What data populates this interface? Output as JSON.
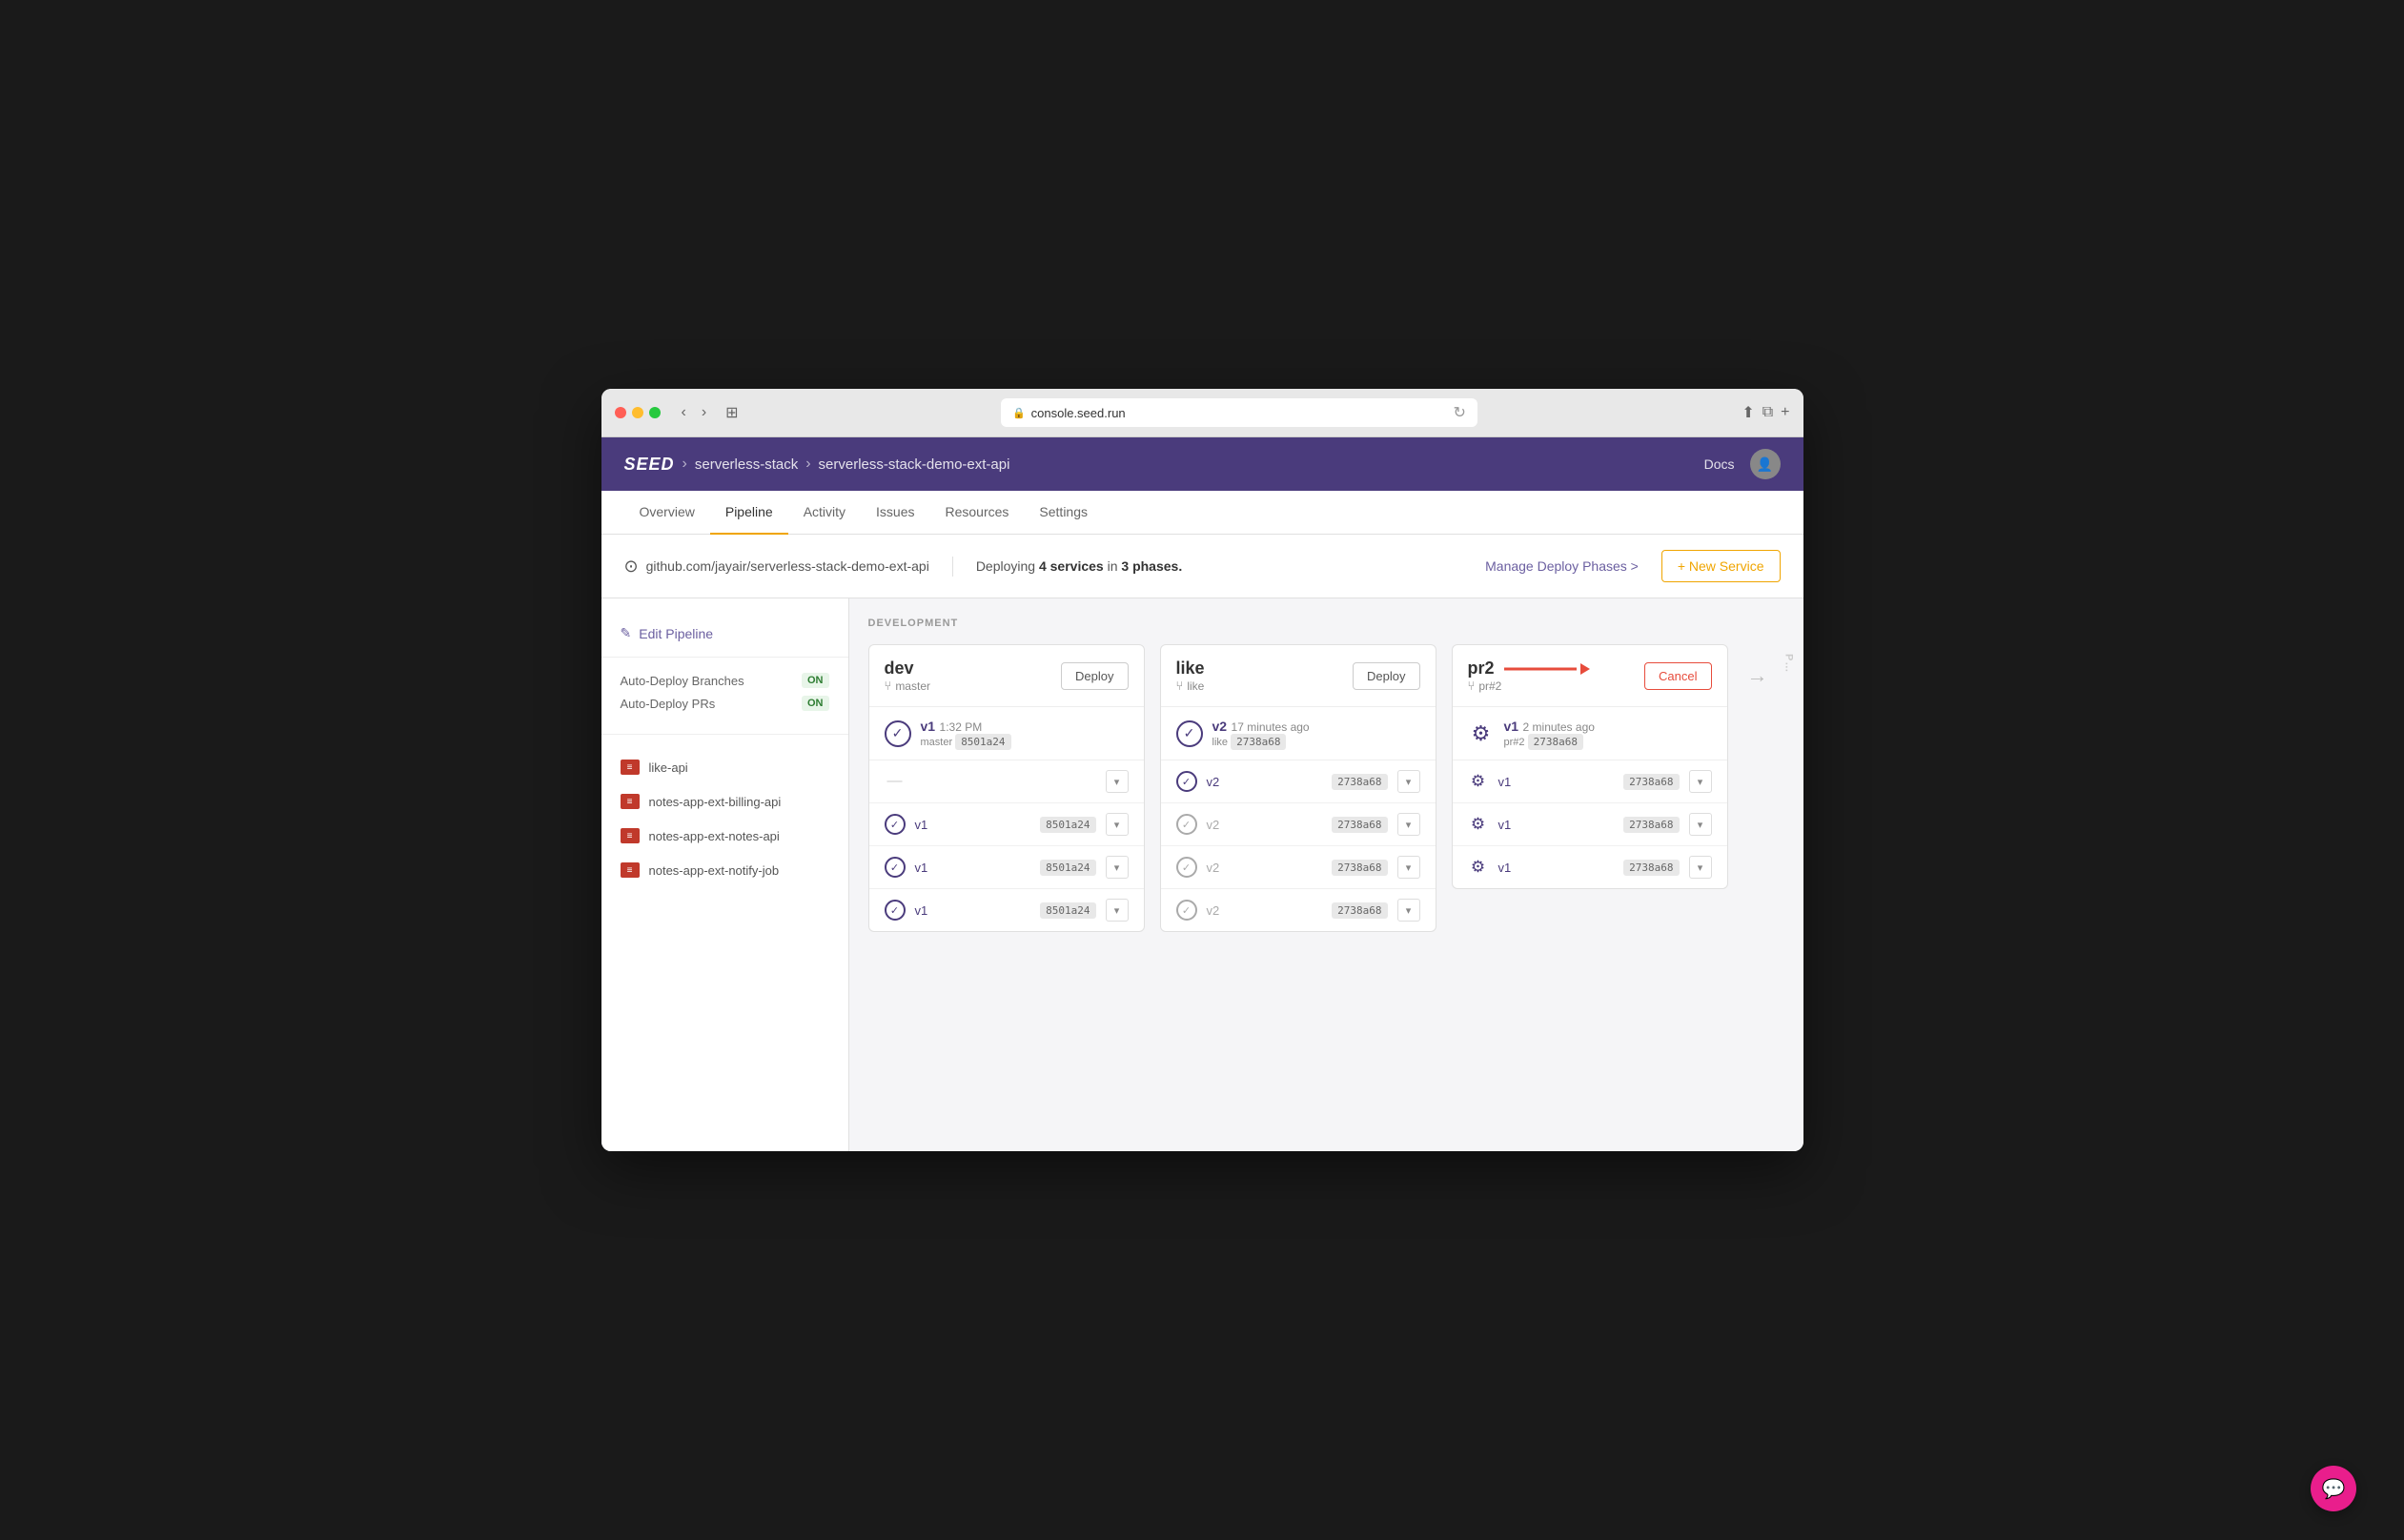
{
  "browser": {
    "url": "console.seed.run",
    "reload_title": "↻"
  },
  "header": {
    "logo": "SEED",
    "breadcrumb": [
      {
        "label": "serverless-stack",
        "sep": ">"
      },
      {
        "label": "serverless-stack-demo-ext-api"
      }
    ],
    "docs_label": "Docs"
  },
  "nav": {
    "tabs": [
      {
        "label": "Overview",
        "active": false
      },
      {
        "label": "Pipeline",
        "active": true
      },
      {
        "label": "Activity",
        "active": false
      },
      {
        "label": "Issues",
        "active": false
      },
      {
        "label": "Resources",
        "active": false
      },
      {
        "label": "Settings",
        "active": false
      }
    ]
  },
  "info_bar": {
    "github_url": "github.com/jayair/serverless-stack-demo-ext-api",
    "deploy_text_prefix": "Deploying",
    "deploy_count": "4 services",
    "deploy_text_mid": "in",
    "deploy_phases": "3 phases.",
    "manage_phases_label": "Manage Deploy Phases >",
    "new_service_label": "+ New Service"
  },
  "sidebar": {
    "edit_pipeline_label": "Edit Pipeline",
    "auto_deploy_branches_label": "Auto-Deploy Branches",
    "auto_deploy_branches_value": "ON",
    "auto_deploy_prs_label": "Auto-Deploy PRs",
    "auto_deploy_prs_value": "ON",
    "services": [
      {
        "name": "like-api"
      },
      {
        "name": "notes-app-ext-billing-api"
      },
      {
        "name": "notes-app-ext-notes-api"
      },
      {
        "name": "notes-app-ext-notify-job"
      }
    ]
  },
  "pipeline": {
    "stage_label": "DEVELOPMENT",
    "stages": [
      {
        "name": "dev",
        "branch": "master",
        "action_label": "Deploy",
        "build_summary": {
          "version": "v1",
          "time": "1:32 PM",
          "branch": "master",
          "commit": "8501a24",
          "status": "success"
        },
        "services": [
          {
            "status": "dash",
            "version": "",
            "commit": ""
          },
          {
            "status": "success",
            "version": "v1",
            "commit": "8501a24"
          },
          {
            "status": "success",
            "version": "v1",
            "commit": "8501a24"
          },
          {
            "status": "success",
            "version": "v1",
            "commit": "8501a24"
          }
        ]
      },
      {
        "name": "like",
        "branch": "like",
        "action_label": "Deploy",
        "build_summary": {
          "version": "v2",
          "time": "17 minutes ago",
          "branch": "like",
          "commit": "2738a68",
          "status": "success"
        },
        "services": [
          {
            "status": "success",
            "version": "v2",
            "commit": "2738a68"
          },
          {
            "status": "success-gray",
            "version": "v2",
            "commit": "2738a68"
          },
          {
            "status": "success-gray",
            "version": "v2",
            "commit": "2738a68"
          },
          {
            "status": "success-gray",
            "version": "v2",
            "commit": "2738a68"
          }
        ]
      },
      {
        "name": "pr2",
        "branch": "pr#2",
        "action_label": "Cancel",
        "has_arrow": true,
        "build_summary": {
          "version": "v1",
          "time": "2 minutes ago",
          "branch": "pr#2",
          "commit": "2738a68",
          "status": "loading"
        },
        "services": [
          {
            "status": "loading",
            "version": "v1",
            "commit": "2738a68"
          },
          {
            "status": "loading",
            "version": "v1",
            "commit": "2738a68"
          },
          {
            "status": "loading",
            "version": "v1",
            "commit": "2738a68"
          }
        ]
      }
    ]
  }
}
